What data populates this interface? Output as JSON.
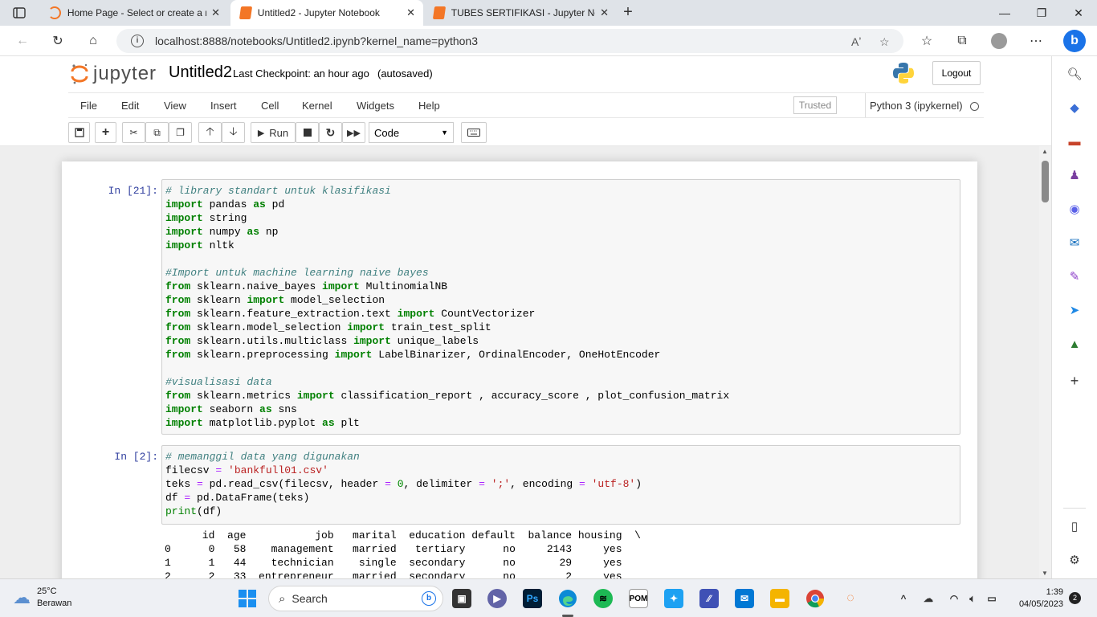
{
  "browser": {
    "tabs": [
      {
        "label": "Home Page - Select or create a n",
        "active": false
      },
      {
        "label": "Untitled2 - Jupyter Notebook",
        "active": true
      },
      {
        "label": "TUBES SERTIFIKASI - Jupyter Not",
        "active": false
      }
    ],
    "url": "localhost:8888/notebooks/Untitled2.ipynb?kernel_name=python3"
  },
  "jupyter": {
    "logo_text": "jupyter",
    "notebook_name": "Untitled2",
    "checkpoint": "Last Checkpoint: an hour ago",
    "autosaved": "(autosaved)",
    "logout_label": "Logout",
    "menu": [
      "File",
      "Edit",
      "View",
      "Insert",
      "Cell",
      "Kernel",
      "Widgets",
      "Help"
    ],
    "trusted": "Trusted",
    "kernel": "Python 3 (ipykernel)",
    "toolbar": {
      "run_label": "Run",
      "cell_type": "Code"
    }
  },
  "cells": [
    {
      "prompt": "In [21]:",
      "lines": [
        "# library standart untuk klasifikasi",
        "import pandas as pd",
        "import string",
        "import numpy as np",
        "import nltk",
        "",
        "#Import untuk machine learning naive bayes",
        "from sklearn.naive_bayes import MultinomialNB",
        "from sklearn import model_selection",
        "from sklearn.feature_extraction.text import CountVectorizer",
        "from sklearn.model_selection import train_test_split",
        "from sklearn.utils.multiclass import unique_labels",
        "from sklearn.preprocessing import LabelBinarizer, OrdinalEncoder, OneHotEncoder",
        "",
        "#visualisasi data",
        "from sklearn.metrics import classification_report , accuracy_score , plot_confusion_matrix",
        "import seaborn as sns",
        "import matplotlib.pyplot as plt"
      ]
    },
    {
      "prompt": "In [2]:",
      "lines": [
        "# memanggil data yang digunakan",
        "filecsv = 'bankfull01.csv'",
        "teks = pd.read_csv(filecsv, header = 0, delimiter = ';', encoding = 'utf-8')",
        "df = pd.DataFrame(teks)",
        "print(df)"
      ],
      "output": [
        "      id  age           job   marital  education default  balance housing  \\",
        "0      0   58    management   married   tertiary      no     2143     yes   ",
        "1      1   44    technician    single  secondary      no       29     yes   ",
        "2      2   33  entrepreneur   married  secondary      no        2     yes   "
      ]
    }
  ],
  "taskbar": {
    "temperature": "25°C",
    "weather": "Berawan",
    "search_placeholder": "Search",
    "time": "1:39",
    "date": "04/05/2023",
    "notifications": "2"
  }
}
